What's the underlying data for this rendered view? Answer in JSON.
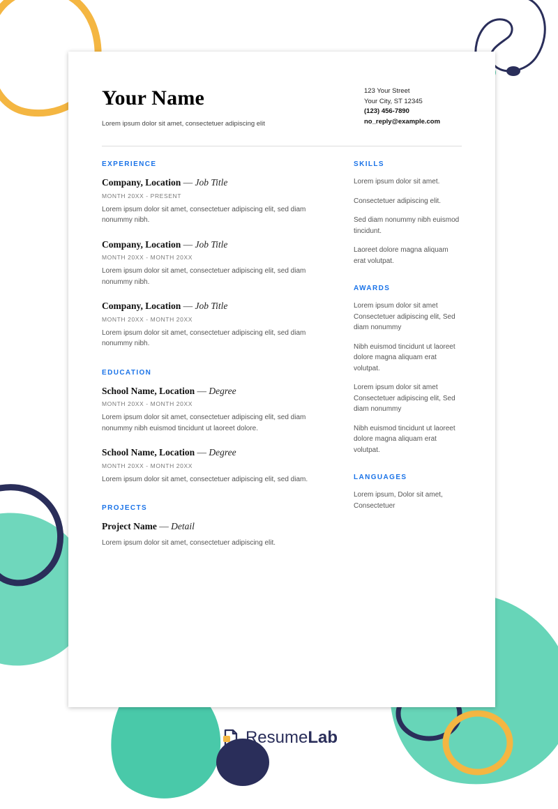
{
  "header": {
    "name": "Your Name",
    "subtitle": "Lorem ipsum dolor sit amet, consectetuer adipiscing elit",
    "address1": "123 Your Street",
    "address2": "Your City, ST 12345",
    "phone": "(123) 456-7890",
    "email": "no_reply@example.com"
  },
  "sections": {
    "experience": {
      "title": "EXPERIENCE",
      "items": [
        {
          "company": "Company,",
          "location": "Location",
          "role": "Job Title",
          "dates": "MONTH 20XX - PRESENT",
          "body": "Lorem ipsum dolor sit amet, consectetuer adipiscing elit, sed diam nonummy nibh."
        },
        {
          "company": "Company,",
          "location": "Location",
          "role": "Job Title",
          "dates": "MONTH 20XX - MONTH 20XX",
          "body": "Lorem ipsum dolor sit amet, consectetuer adipiscing elit, sed diam nonummy nibh."
        },
        {
          "company": "Company,",
          "location": "Location",
          "role": "Job Title",
          "dates": "MONTH 20XX - MONTH 20XX",
          "body": "Lorem ipsum dolor sit amet, consectetuer adipiscing elit, sed diam nonummy nibh."
        }
      ]
    },
    "education": {
      "title": "EDUCATION",
      "items": [
        {
          "school": "School Name,",
          "location": "Location",
          "degree": "Degree",
          "dates": "MONTH 20XX - MONTH 20XX",
          "body": "Lorem ipsum dolor sit amet, consectetuer adipiscing elit, sed diam nonummy nibh euismod tincidunt ut laoreet dolore."
        },
        {
          "school": "School Name,",
          "location": "Location",
          "degree": "Degree",
          "dates": "MONTH 20XX - MONTH 20XX",
          "body": "Lorem ipsum dolor sit amet, consectetuer adipiscing elit, sed diam."
        }
      ]
    },
    "projects": {
      "title": "PROJECTS",
      "items": [
        {
          "name": "Project Name",
          "detail": "Detail",
          "body": "Lorem ipsum dolor sit amet, consectetuer adipiscing elit."
        }
      ]
    },
    "skills": {
      "title": "SKILLS",
      "blocks": [
        "Lorem ipsum dolor sit amet.",
        "Consectetuer adipiscing elit.",
        "Sed diam nonummy nibh euismod tincidunt.",
        "Laoreet dolore magna aliquam erat volutpat."
      ]
    },
    "awards": {
      "title": "AWARDS",
      "blocks": [
        "Lorem ipsum dolor sit amet Consectetuer adipiscing elit, Sed diam nonummy",
        "Nibh euismod tincidunt ut laoreet dolore magna aliquam erat volutpat.",
        "Lorem ipsum dolor sit amet Consectetuer adipiscing elit, Sed diam nonummy",
        "Nibh euismod tincidunt ut laoreet dolore magna aliquam erat volutpat."
      ]
    },
    "languages": {
      "title": "LANGUAGES",
      "blocks": [
        "Lorem ipsum, Dolor sit amet, Consectetuer"
      ]
    }
  },
  "brand": {
    "text1": "Resume",
    "text2": "Lab"
  }
}
